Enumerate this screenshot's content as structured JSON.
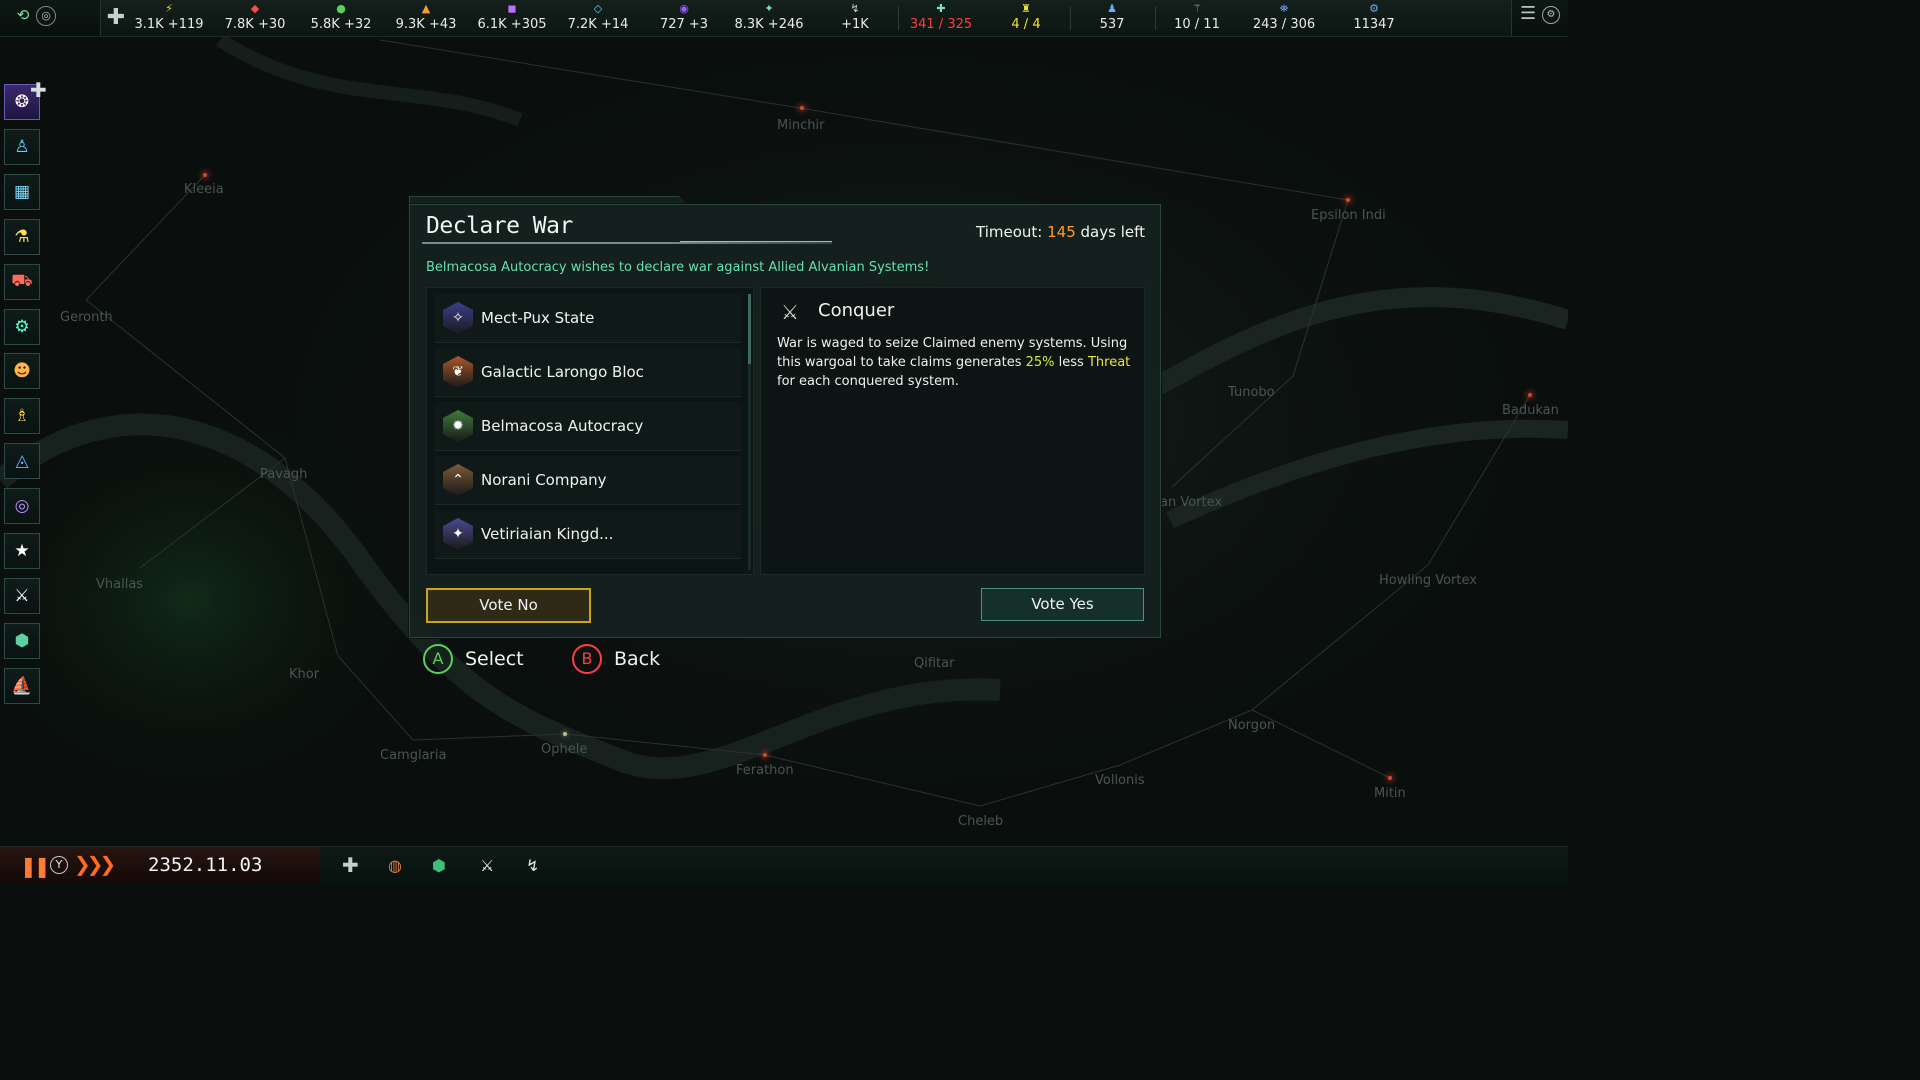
{
  "galaxy": {
    "systems": [
      {
        "name": "Minchir"
      },
      {
        "name": "Kleeia"
      },
      {
        "name": "Epsilon Indi"
      },
      {
        "name": "Geronth"
      },
      {
        "name": "Tunobo"
      },
      {
        "name": "Badukan"
      },
      {
        "name": "Pavagh"
      },
      {
        "name": "an Vortex"
      },
      {
        "name": "Howling Vortex"
      },
      {
        "name": "Vhallas"
      },
      {
        "name": "Khor"
      },
      {
        "name": "Qifitar"
      },
      {
        "name": "Norgon"
      },
      {
        "name": "Camglaria"
      },
      {
        "name": "Ophele"
      },
      {
        "name": "Ferathon"
      },
      {
        "name": "Vollonis"
      },
      {
        "name": "Mitin"
      },
      {
        "name": "Cheleb"
      }
    ]
  },
  "topbar": {
    "resources": [
      {
        "icon": "influence-plus-icon",
        "glyph": "✚",
        "color": "#c8d0cd",
        "value": ""
      },
      {
        "icon": "energy-icon",
        "glyph": "⚡",
        "color": "#f0d43a",
        "value": "3.1K +119"
      },
      {
        "icon": "minerals-icon",
        "glyph": "◆",
        "color": "#ff4747",
        "value": "7.8K +30"
      },
      {
        "icon": "food-icon",
        "glyph": "●",
        "color": "#58d05a",
        "value": "5.8K +32"
      },
      {
        "icon": "consumer-goods-icon",
        "glyph": "▲",
        "color": "#ff9b2a",
        "value": "9.3K +43"
      },
      {
        "icon": "alloys-icon",
        "glyph": "◼",
        "color": "#c270ff",
        "value": "6.1K +305"
      },
      {
        "icon": "influence-icon",
        "glyph": "◇",
        "color": "#4fd8ff",
        "value": "7.2K +14"
      },
      {
        "icon": "unity-icon",
        "glyph": "◉",
        "color": "#9b5cff",
        "value": "727 +3"
      },
      {
        "icon": "research-icon",
        "glyph": "✦",
        "color": "#7ce0c8",
        "value": "8.3K +246"
      },
      {
        "icon": "trade-icon",
        "glyph": "↯",
        "color": "#c8d0cd",
        "value": "+1K"
      },
      {
        "icon": "naval-capacity-icon",
        "glyph": "✚",
        "color": "#7ce0c8",
        "value": "341 / 325",
        "style": "red"
      },
      {
        "icon": "starbase-capacity-icon",
        "glyph": "♜",
        "color": "#f2e233",
        "value": "4 / 4",
        "style": "yellow"
      },
      {
        "icon": "pops-icon",
        "glyph": "♟",
        "color": "#6fa8ff",
        "value": "537"
      },
      {
        "icon": "planets-icon",
        "glyph": "⚚",
        "color": "#58d05a",
        "value": "10 / 11"
      },
      {
        "icon": "fleet-icon",
        "glyph": "⛯",
        "color": "#6fa8ff",
        "value": "243 / 306"
      },
      {
        "icon": "empire-size-icon",
        "glyph": "⚙",
        "color": "#6fa8ff",
        "value": "11347"
      }
    ]
  },
  "sidebar": {
    "items": [
      {
        "name": "empire-emblem",
        "glyph": "❂",
        "color": "#ffffff",
        "active": true
      },
      {
        "name": "government",
        "glyph": "♙",
        "color": "#5cd0ff"
      },
      {
        "name": "planets-list",
        "glyph": "▦",
        "color": "#7fdcff"
      },
      {
        "name": "technology",
        "glyph": "⚗",
        "color": "#ffe24a"
      },
      {
        "name": "ships",
        "glyph": "⛟",
        "color": "#ff6a5a"
      },
      {
        "name": "traditions",
        "glyph": "⚙",
        "color": "#5cffd0"
      },
      {
        "name": "policies",
        "glyph": "☻",
        "color": "#ffb347"
      },
      {
        "name": "leaders",
        "glyph": "♗",
        "color": "#ffd24a"
      },
      {
        "name": "federation",
        "glyph": "◬",
        "color": "#6fa8ff"
      },
      {
        "name": "galactic-community",
        "glyph": "◎",
        "color": "#b98cff"
      },
      {
        "name": "contacts",
        "glyph": "★",
        "color": "#ffffff"
      },
      {
        "name": "wars",
        "glyph": "⚔",
        "color": "#ffffff"
      },
      {
        "name": "archaeology",
        "glyph": "⬢",
        "color": "#5cd0a0"
      },
      {
        "name": "fleet-manager",
        "glyph": "⛵",
        "color": "#5cd0ff"
      }
    ]
  },
  "dialog": {
    "title": "Declare War",
    "timeout_label": "Timeout:",
    "timeout_days": "145",
    "timeout_suffix": "days left",
    "message": "Belmacosa Autocracy wishes to declare war against Allied Alvanian Systems!",
    "empires": [
      {
        "name": "Mect-Pux State",
        "color": "#3b3f8f",
        "glyph": "✧"
      },
      {
        "name": "Galactic Larongo Bloc",
        "color": "#a8582a",
        "glyph": "❦"
      },
      {
        "name": "Belmacosa Autocracy",
        "color": "#3f7a3a",
        "glyph": "✹"
      },
      {
        "name": "Norani Company",
        "color": "#7a5a3a",
        "glyph": "⌃"
      },
      {
        "name": "Vetiriaian Kingd...",
        "color": "#4a4a8f",
        "glyph": "✦"
      }
    ],
    "wargoal": {
      "title": "Conquer",
      "desc_part1": "War is waged to seize Claimed enemy systems. Using this wargoal to take claims generates ",
      "desc_pct": "25%",
      "desc_part2": " less ",
      "desc_threat": "Threat",
      "desc_part3": " for each conquered system."
    },
    "vote_no": "Vote No",
    "vote_yes": "Vote Yes"
  },
  "hints": {
    "select_key": "A",
    "select_label": "Select",
    "back_key": "B",
    "back_label": "Back"
  },
  "bottombar": {
    "y_key": "Y",
    "date": "2352.11.03"
  }
}
